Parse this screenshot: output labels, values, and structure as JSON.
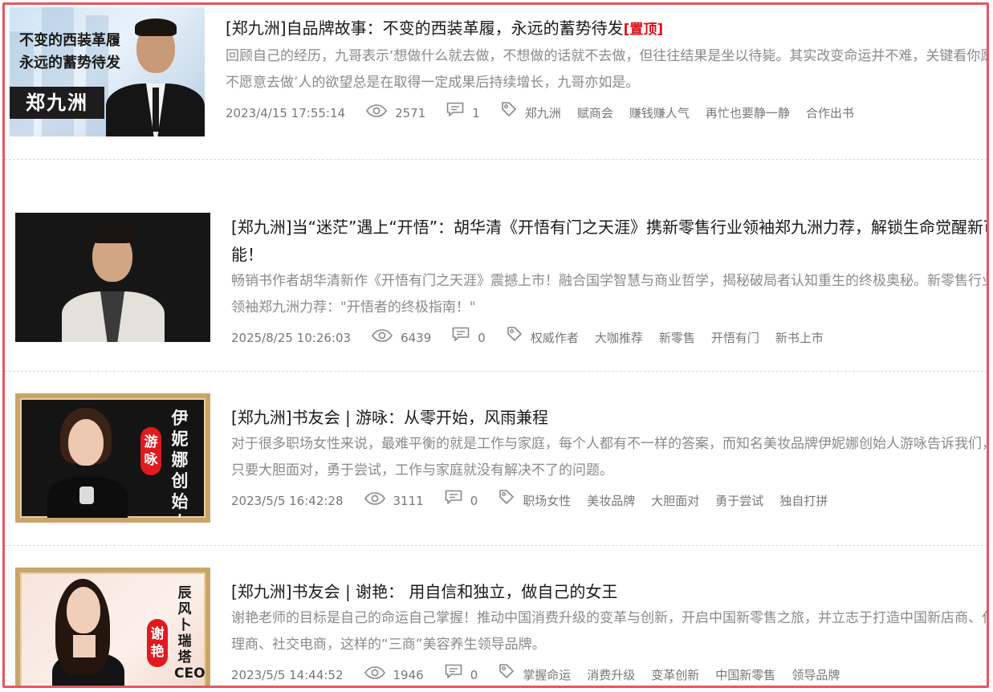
{
  "articles": [
    {
      "title": "[郑九洲]自品牌故事：不变的西装革履，永远的蓄势待发",
      "pinned_label": "[置顶]",
      "excerpt": "回顾自己的经历，九哥表示‘想做什么就去做，不想做的话就不去做，但往往结果是坐以待毙。其实改变命运并不难，关键看你愿不愿意去做’人的欲望总是在取得一定成果后持续增长，九哥亦如是。",
      "date": "2023/4/15 17:55:14",
      "views": "2571",
      "comments": "1",
      "tags": [
        "郑九洲",
        "赋商会",
        "赚钱赚人气",
        "再忙也要静一静",
        "合作出书"
      ],
      "thumb": {
        "line1": "不变的西装革履",
        "line2": "永远的蓄势待发",
        "name": "郑九洲"
      }
    },
    {
      "title": "[郑九洲]当“迷茫”遇上“开悟”：胡华清《开悟有门之天涯》携新零售行业领袖郑九洲力荐，解锁生命觉醒新可能！",
      "excerpt": "畅销书作者胡华清新作《开悟有门之天涯》震撼上市！融合国学智慧与商业哲学，揭秘破局者认知重生的终极奥秘。新零售行业领袖郑九洲力荐：\"开悟者的终极指南！\"",
      "date": "2025/8/25 10:26:03",
      "views": "6439",
      "comments": "0",
      "tags": [
        "权威作者",
        "大咖推荐",
        "新零售",
        "开悟有门",
        "新书上市"
      ]
    },
    {
      "title": "[郑九洲]书友会 | 游咏：从零开始，风雨兼程",
      "excerpt": "对于很多职场女性来说，最难平衡的就是工作与家庭，每个人都有不一样的答案，而知名美妆品牌伊妮娜创始人游咏告诉我们，只要大胆面对，勇于尝试，工作与家庭就没有解决不了的问题。",
      "date": "2023/5/5 16:42:28",
      "views": "3111",
      "comments": "0",
      "tags": [
        "职场女性",
        "美妆品牌",
        "大胆面对",
        "勇于尝试",
        "独自打拼"
      ],
      "thumb": {
        "pill": "游咏",
        "vertical": "伊妮娜创始人"
      }
    },
    {
      "title": "[郑九洲]书友会 | 谢艳： 用自信和独立，做自己的女王",
      "excerpt": "谢艳老师的目标是自己的命运自己掌握！推动中国消费升级的变革与创新，开启中国新零售之旅，并立志于打造中国新店商、代理商、社交电商，这样的“三商”美容养生领导品牌。",
      "date": "2023/5/5 14:44:52",
      "views": "1946",
      "comments": "0",
      "tags": [
        "掌握命运",
        "消费升级",
        "变革创新",
        "中国新零售",
        "领导品牌"
      ],
      "thumb": {
        "pill": "谢艳",
        "vertical": "辰风卜瑞塔CEO"
      }
    }
  ],
  "colors": {
    "border": "#e8555f",
    "pinned": "#e0101a",
    "excerpt": "#8a8a8a",
    "meta": "#777777"
  },
  "icons": {
    "views": "eye-icon",
    "comments": "comment-icon",
    "tags": "tag-icon"
  }
}
